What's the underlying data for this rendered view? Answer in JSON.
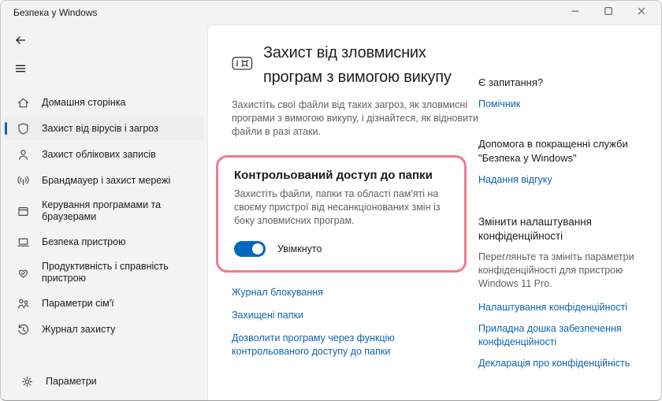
{
  "window": {
    "title": "Безпека у Windows",
    "controls": [
      {
        "name": "minimize-icon"
      },
      {
        "name": "maximize-icon"
      },
      {
        "name": "close-icon"
      }
    ]
  },
  "sidebar": {
    "back_icon": "back-arrow-icon",
    "menu_icon": "hamburger-icon",
    "items": [
      {
        "label": "Домашня сторінка",
        "icon": "home-icon",
        "selected": false
      },
      {
        "label": "Захист від вірусів і загроз",
        "icon": "shield-icon",
        "selected": true
      },
      {
        "label": "Захист облікових записів",
        "icon": "account-icon",
        "selected": false
      },
      {
        "label": "Брандмауер і захист мережі",
        "icon": "network-icon",
        "selected": false
      },
      {
        "label": "Керування програмами та браузерами",
        "icon": "apps-browser-icon",
        "selected": false
      },
      {
        "label": "Безпека пристрою",
        "icon": "device-icon",
        "selected": false
      },
      {
        "label": "Продуктивність і справність пристрою",
        "icon": "device-health-icon",
        "selected": false
      },
      {
        "label": "Параметри сім'ї",
        "icon": "family-icon",
        "selected": false
      },
      {
        "label": "Журнал захисту",
        "icon": "history-icon",
        "selected": false
      }
    ],
    "footer": {
      "label": "Параметри",
      "icon": "gear-icon"
    }
  },
  "main": {
    "icon": "ransomware-icon",
    "title": "Захист від зловмисних програм з вимогою викупу",
    "description": "Захистіть свої файли від таких загроз, як зловмисні програми з вимогою викупу, і дізнайтеся, як відновити файли в разі атаки.",
    "highlight": {
      "title": "Контрольований доступ до папки",
      "description": "Захистіть файли, папки та області пам'яті на своєму пристрої від несанкціонованих змін із боку зловмисних програм.",
      "toggle": {
        "state": "on",
        "label": "Увімкнуто"
      },
      "border_color": "#ed7d88"
    },
    "links": [
      "Журнал блокування",
      "Захищені папки",
      "Дозволити програму через функцію контрольованого доступу до папки"
    ]
  },
  "aside": {
    "sections": [
      {
        "heading": "Є запитання?",
        "links": [
          "Помічник"
        ]
      },
      {
        "heading": "Допомога в покращенні служби \"Безпека у Windows\"",
        "links": [
          "Надання відгуку"
        ]
      },
      {
        "heading": "Змінити налаштування конфіденційності",
        "description": "Перегляньте та змініть параметри конфіденційності для пристрою Windows 11 Pro.",
        "links": [
          "Налаштування конфіденційності",
          "Приладна дошка забезпечення конфіденційності",
          "Декларація про конфіденційність"
        ]
      }
    ]
  },
  "colors": {
    "accent_blue": "#0067c0",
    "link_blue": "#0f62ae",
    "highlight_border": "#ed7d88",
    "window_bg": "#f3f3f3",
    "card_bg": "#ffffff"
  }
}
